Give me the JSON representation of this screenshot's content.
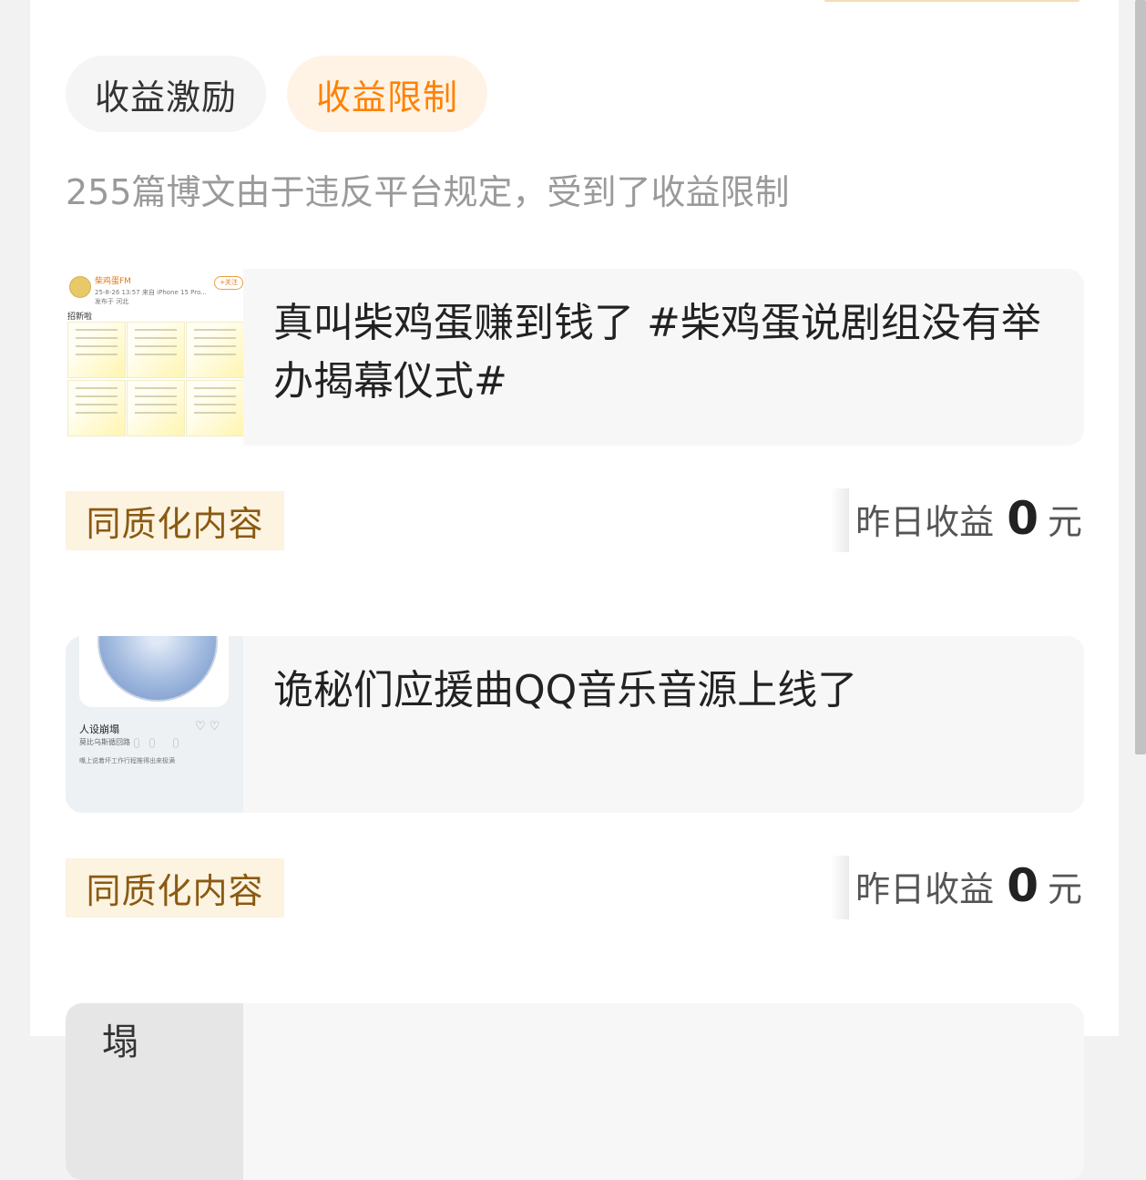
{
  "tabs": {
    "incentive": "收益激励",
    "restriction": "收益限制"
  },
  "notice": "255篇博文由于违反平台规定，受到了收益限制",
  "posts": [
    {
      "title": "真叫柴鸡蛋赚到钱了 #柴鸡蛋说剧组没有举办揭幕仪式#",
      "tag": "同质化内容",
      "earn_label": "昨日收益",
      "earn_value": "0",
      "earn_unit": "元",
      "thumb": {
        "name": "柴鸡蛋FM",
        "meta": "25-8-26 13:57 来自 iPhone 15 Pro...",
        "meta2": "发布于 河北",
        "follow": "+关注",
        "caption": "招新啦"
      }
    },
    {
      "title": "诡秘们应援曲QQ音乐音源上线了",
      "tag": "同质化内容",
      "earn_label": "昨日收益",
      "earn_value": "0",
      "earn_unit": "元",
      "thumb": {
        "song": "人设崩塌",
        "artist": "莫比乌斯循回路",
        "line": "嘴上说着坏工作行程推得出来极满",
        "icons": "♡♡"
      }
    },
    {
      "thumb": {
        "glyph": "塌"
      }
    }
  ],
  "colors": {
    "accent": "#ff8200",
    "accent_bg": "#fff3e6",
    "tag_bg": "#fdf3e1",
    "tag_text": "#8a5a12"
  }
}
